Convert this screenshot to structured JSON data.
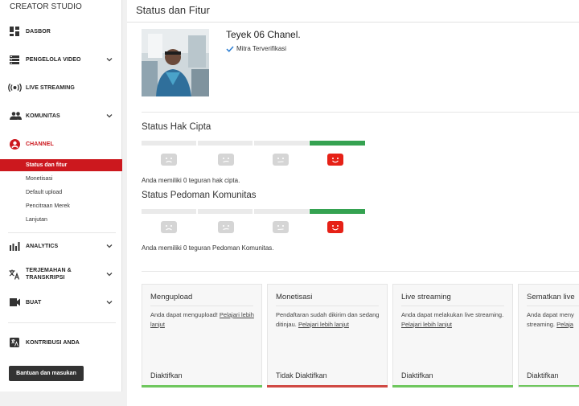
{
  "sidebar": {
    "title": "CREATOR STUDIO",
    "items": [
      {
        "label": "DASBOR",
        "icon": "dashboard-icon"
      },
      {
        "label": "PENGELOLA VIDEO",
        "icon": "video-manager-icon"
      },
      {
        "label": "LIVE STREAMING",
        "icon": "live-icon"
      },
      {
        "label": "KOMUNITAS",
        "icon": "community-icon"
      },
      {
        "label": "CHANNEL",
        "icon": "channel-icon"
      },
      {
        "label": "ANALYTICS",
        "icon": "analytics-icon"
      },
      {
        "label": "TERJEMAHAN &",
        "label2": "TRANSKRIPSI",
        "icon": "translate-icon"
      },
      {
        "label": "BUAT",
        "icon": "create-icon"
      },
      {
        "label": "KONTRIBUSI ANDA",
        "icon": "contribution-icon"
      }
    ],
    "channel_sub": [
      "Status dan fitur",
      "Monetisasi",
      "Default upload",
      "Pencitraan Merek",
      "Lanjutan"
    ],
    "help_button": "Bantuan dan masukan",
    "accent": "#cc181e"
  },
  "main": {
    "page_title": "Status dan Fitur",
    "channel_name": "Teyek 06 Chanel.",
    "verified_label": "Mitra Terverifikasi",
    "copyright": {
      "title": "Status Hak Cipta",
      "text": "Anda memiliki 0 teguran hak cipta.",
      "strikes": 0
    },
    "guidelines": {
      "title": "Status Pedoman Komunitas",
      "text": "Anda memiliki 0 teguran Pedoman Komunitas.",
      "strikes": 0
    },
    "features": [
      {
        "title": "Mengupload",
        "desc": "Anda dapat mengupload!",
        "link": "Pelajari lebih lanjut",
        "status": "Diaktifkan",
        "state": "on"
      },
      {
        "title": "Monetisasi",
        "desc": "Pendaftaran sudah dikirim dan sedang ditinjau.",
        "link": "Pelajari lebih lanjut",
        "status": "Tidak Diaktifkan",
        "state": "off"
      },
      {
        "title": "Live streaming",
        "desc": "Anda dapat melakukan live streaming.",
        "link": "Pelajari lebih lanjut",
        "status": "Diaktifkan",
        "state": "on"
      },
      {
        "title": "Sematkan live",
        "desc": "Anda dapat meny streaming.",
        "link": "Pelaja",
        "status": "Diaktifkan",
        "state": "on"
      }
    ]
  }
}
